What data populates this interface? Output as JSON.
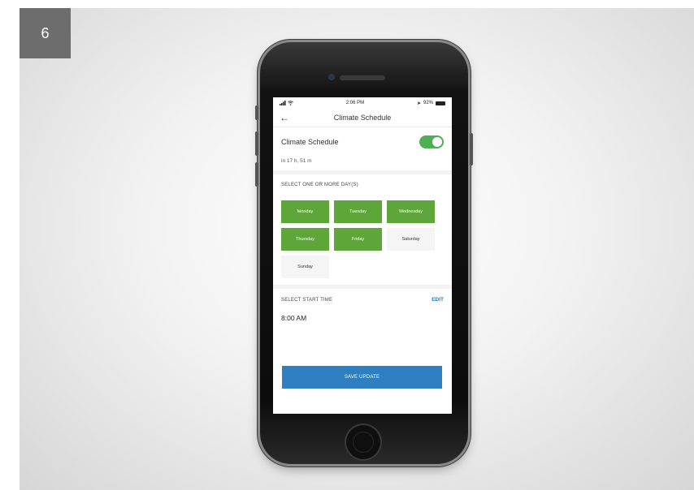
{
  "step": {
    "number": "6"
  },
  "status_bar": {
    "time": "2:06 PM",
    "battery": "92%"
  },
  "header": {
    "title": "Climate Schedule"
  },
  "schedule": {
    "label": "Climate Schedule",
    "enabled": true,
    "countdown": "in 17 h, 51 m"
  },
  "days_section": {
    "heading": "SELECT ONE OR MORE DAY(S)",
    "days": [
      {
        "label": "Monday",
        "selected": true
      },
      {
        "label": "Tuesday",
        "selected": true
      },
      {
        "label": "Wednesday",
        "selected": true
      },
      {
        "label": "Thursday",
        "selected": true
      },
      {
        "label": "Friday",
        "selected": true
      },
      {
        "label": "Saturday",
        "selected": false
      },
      {
        "label": "Sunday",
        "selected": false
      }
    ]
  },
  "start_time": {
    "heading": "SELECT START TIME",
    "edit_label": "EDIT",
    "value": "8:00 AM"
  },
  "save_button": {
    "label": "SAVE UPDATE"
  },
  "colors": {
    "accent_green": "#5ea53a",
    "toggle_green": "#4caf50",
    "primary_blue": "#2d7fc1",
    "badge_gray": "#6d6d6d"
  }
}
